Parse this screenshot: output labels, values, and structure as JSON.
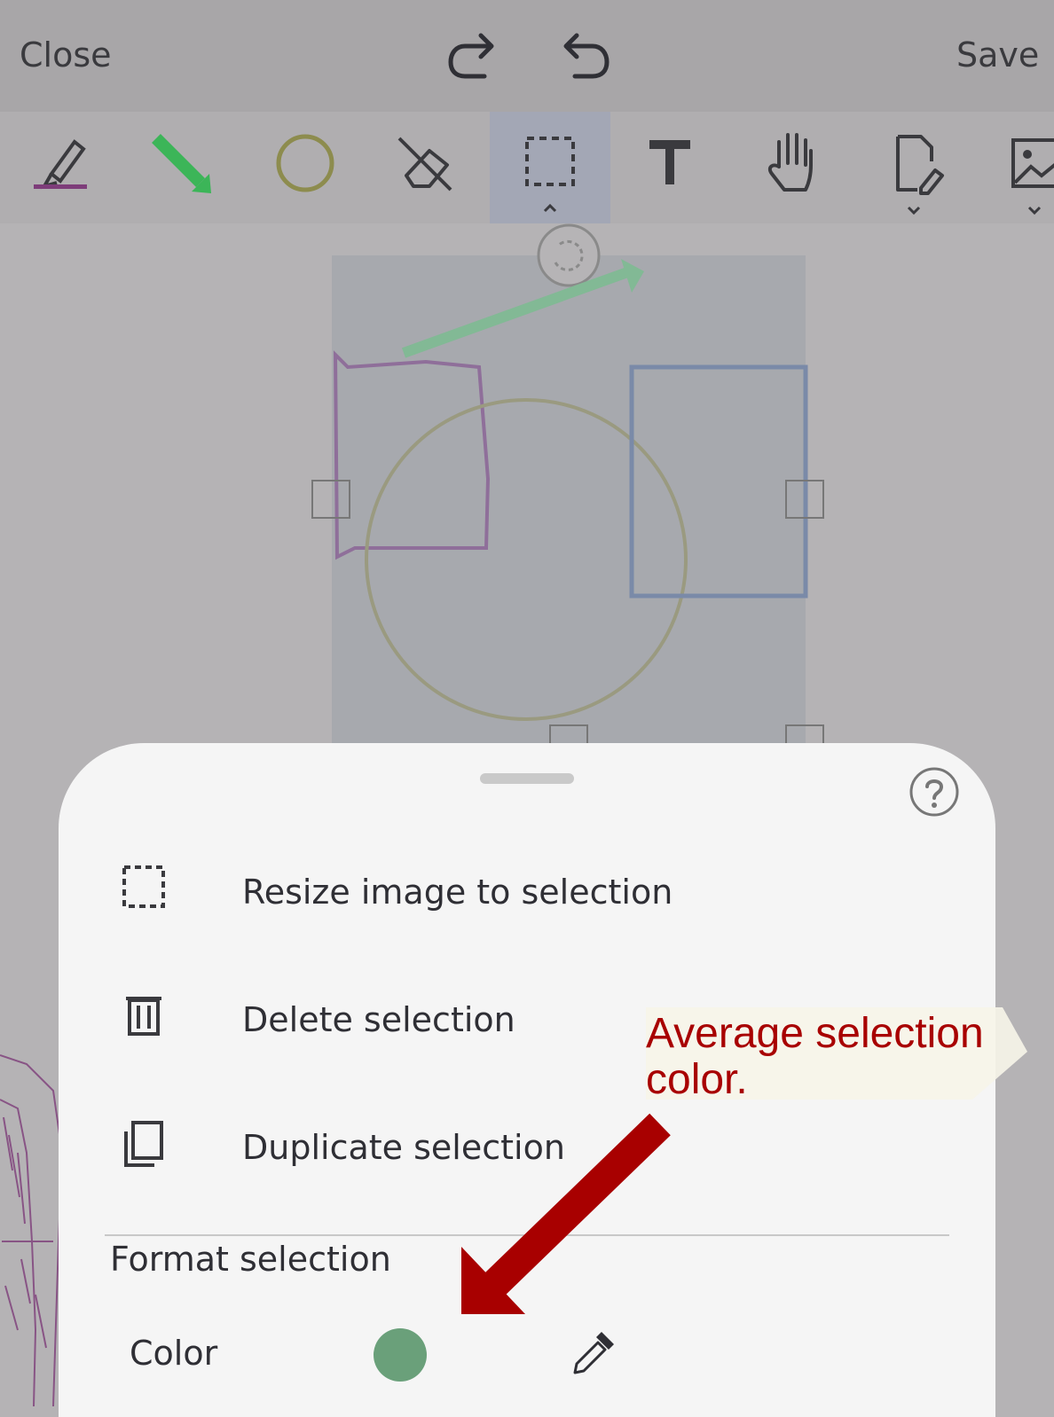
{
  "header": {
    "close_label": "Close",
    "save_label": "Save",
    "redo_icon": "redo-icon",
    "undo_icon": "undo-icon"
  },
  "toolbar": {
    "tools": [
      {
        "name": "highlighter-pen"
      },
      {
        "name": "arrow-pen"
      },
      {
        "name": "circle-shape"
      },
      {
        "name": "eraser"
      },
      {
        "name": "selection"
      },
      {
        "name": "text"
      },
      {
        "name": "pan"
      },
      {
        "name": "page-edit"
      },
      {
        "name": "image-insert"
      }
    ]
  },
  "menu": {
    "resize_label": "Resize image to selection",
    "delete_label": "Delete selection",
    "duplicate_label": "Duplicate selection",
    "format_heading": "Format selection",
    "color_label": "Color",
    "selection_color": "#6aa07a"
  },
  "annotation": {
    "line1": "Average selection",
    "line2": "color."
  },
  "colors": {
    "accent_red": "#a80000",
    "highlighter": "#7e3d7a",
    "arrow_green": "#3cb558",
    "circle_olive": "#8d8c4e"
  }
}
